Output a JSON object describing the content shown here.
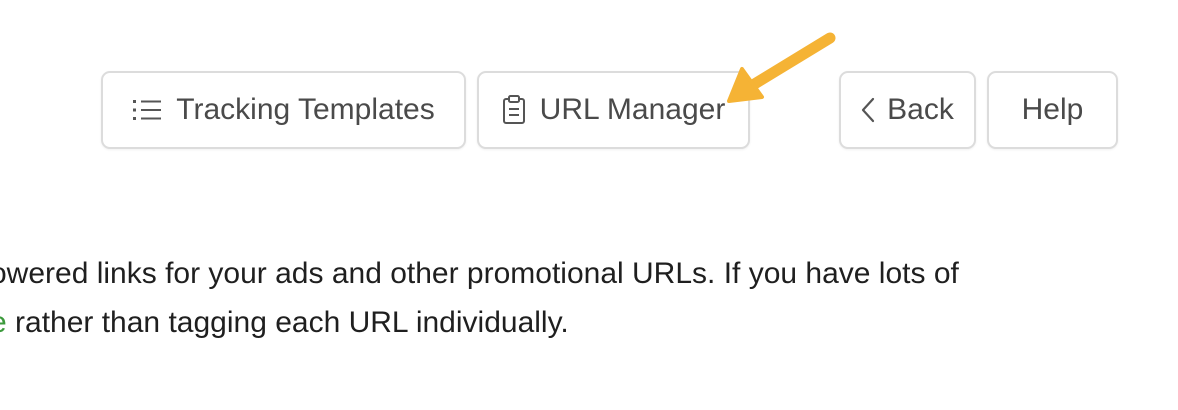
{
  "toolbar": {
    "tracking_templates_label": "Tracking Templates",
    "url_manager_label": "URL Manager",
    "back_label": "Back",
    "help_label": "Help",
    "tracking_templates_icon": "list-icon",
    "url_manager_icon": "clipboard-icon",
    "back_icon": "chevron-left-icon"
  },
  "annotation": {
    "arrow_color": "#F5B335",
    "arrow_icon": "pointer-arrow-icon"
  },
  "description": {
    "line1": "owered links for your ads and other promotional URLs. If you have lots of",
    "line2_link_fragment": "e",
    "line2_rest": " rather than tagging each URL individually.",
    "link_color": "#3C9A3C"
  }
}
